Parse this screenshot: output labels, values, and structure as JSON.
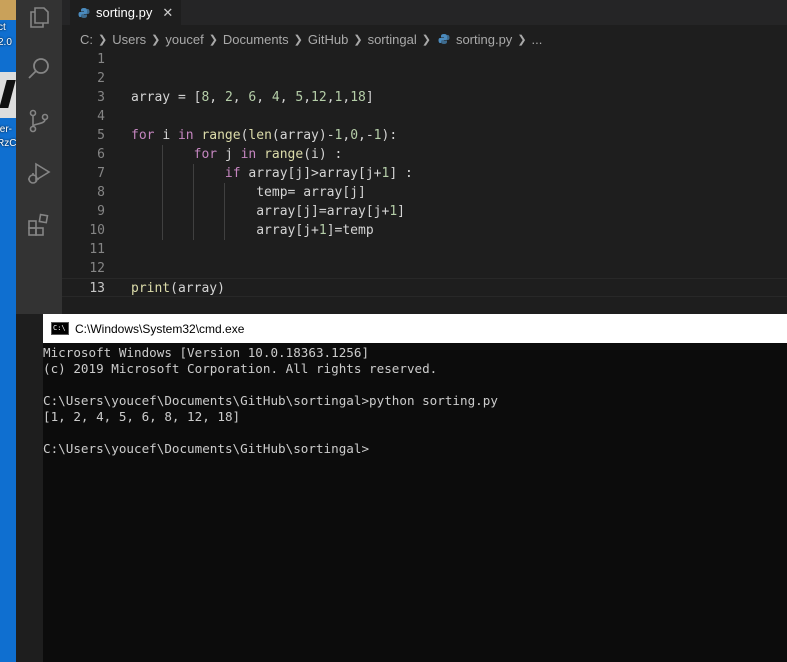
{
  "desktop": {
    "labels": [
      "ct",
      "2.0",
      "ter-",
      "RzC"
    ]
  },
  "activity_bar": {
    "icons": [
      "explorer-icon",
      "search-icon",
      "source-control-icon",
      "run-debug-icon",
      "extensions-icon"
    ]
  },
  "tab": {
    "label": "sorting.py",
    "close": "✕"
  },
  "breadcrumb": {
    "items": [
      "C:",
      "Users",
      "youcef",
      "Documents",
      "GitHub",
      "sortingal",
      "sorting.py",
      "..."
    ]
  },
  "editor": {
    "current_line": 13,
    "lines": [
      {
        "num": "1",
        "code": ""
      },
      {
        "num": "2",
        "code": ""
      },
      {
        "num": "3",
        "code": "array = [8, 2, 6, 4, 5,12,1,18]"
      },
      {
        "num": "4",
        "code": ""
      },
      {
        "num": "5",
        "code": "for i in range(len(array)-1,0,-1):"
      },
      {
        "num": "6",
        "code": "        for j in range(i) :"
      },
      {
        "num": "7",
        "code": "            if array[j]>array[j+1] :"
      },
      {
        "num": "8",
        "code": "                temp= array[j]"
      },
      {
        "num": "9",
        "code": "                array[j]=array[j+1]"
      },
      {
        "num": "10",
        "code": "                array[j+1]=temp"
      },
      {
        "num": "11",
        "code": ""
      },
      {
        "num": "12",
        "code": ""
      },
      {
        "num": "13",
        "code": "print(array)"
      }
    ]
  },
  "cmd": {
    "title": "C:\\Windows\\System32\\cmd.exe",
    "lines": [
      "Microsoft Windows [Version 10.0.18363.1256]",
      "(c) 2019 Microsoft Corporation. All rights reserved.",
      "",
      "C:\\Users\\youcef\\Documents\\GitHub\\sortingal>python sorting.py",
      "[1, 2, 4, 5, 6, 8, 12, 18]",
      "",
      "C:\\Users\\youcef\\Documents\\GitHub\\sortingal>"
    ]
  },
  "colors": {
    "keyword": "#c586c0",
    "function": "#dcdcaa",
    "number": "#b5cea8",
    "text": "#d4d4d4",
    "python_icon": "#4b8bbe"
  }
}
